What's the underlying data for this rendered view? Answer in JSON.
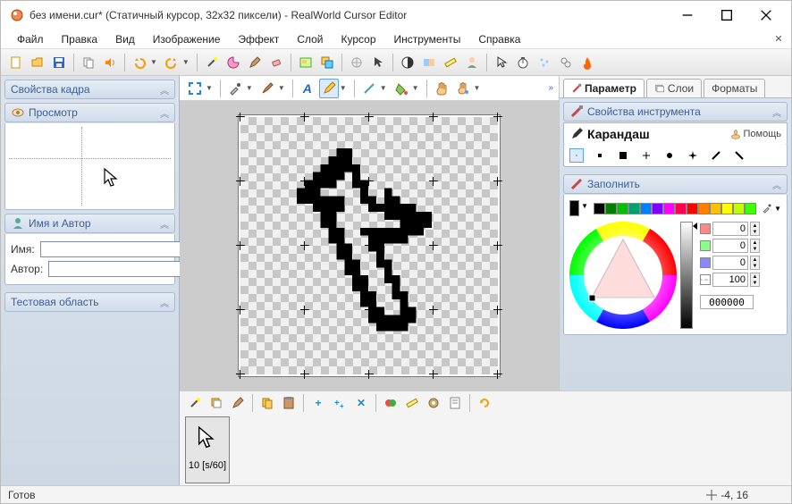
{
  "title": "без имени.cur* (Статичный курсор, 32x32 пиксели) - RealWorld Cursor Editor",
  "menus": [
    "Файл",
    "Правка",
    "Вид",
    "Изображение",
    "Эффект",
    "Слой",
    "Курсор",
    "Инструменты",
    "Справка"
  ],
  "leftPanels": {
    "frameProps": "Свойства кадра",
    "preview": "Просмотр",
    "nameAuthor": {
      "title": "Имя и Автор",
      "nameLabel": "Имя:",
      "authorLabel": "Автор:",
      "nameValue": "",
      "authorValue": ""
    },
    "testArea": "Тестовая область"
  },
  "frames": {
    "durationLabel": "10 [s/60]"
  },
  "rightTabs": {
    "params": "Параметр",
    "layers": "Слои",
    "formats": "Форматы"
  },
  "toolProps": {
    "title": "Свойства инструмента",
    "toolName": "Карандаш",
    "help": "Помощь"
  },
  "fill": {
    "title": "Заполнить"
  },
  "color": {
    "r": "0",
    "g": "0",
    "b": "0",
    "a": "100",
    "hex": "000000",
    "swatches": [
      "#000000",
      "#008000",
      "#00c000",
      "#00a070",
      "#0080ff",
      "#8000ff",
      "#ff00ff",
      "#ff0050",
      "#ff0000",
      "#ff8000",
      "#ffc000",
      "#ffff00",
      "#c0ff00",
      "#40ff00"
    ]
  },
  "status": {
    "ready": "Готов",
    "coords": "-4, 16"
  }
}
